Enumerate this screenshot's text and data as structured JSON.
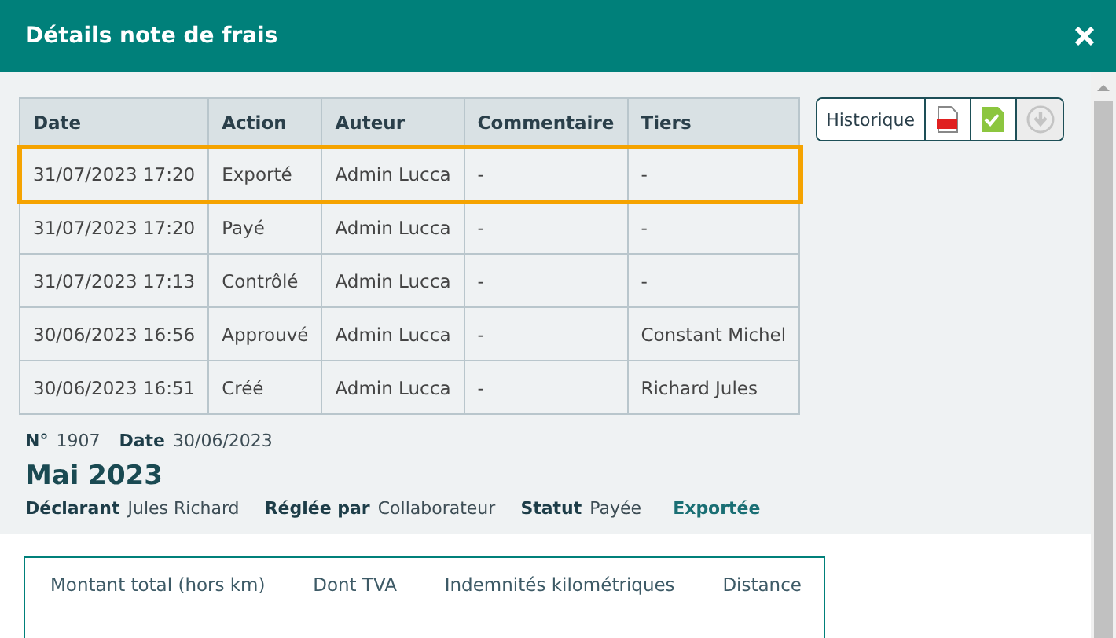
{
  "window": {
    "title": "Détails note de frais"
  },
  "history": {
    "columns": [
      "Date",
      "Action",
      "Auteur",
      "Commentaire",
      "Tiers"
    ],
    "rows": [
      {
        "cells": [
          "31/07/2023 17:20",
          "Exporté",
          "Admin Lucca",
          "-",
          "-"
        ],
        "selected": true
      },
      {
        "cells": [
          "31/07/2023 17:20",
          "Payé",
          "Admin Lucca",
          "-",
          "-"
        ],
        "selected": false
      },
      {
        "cells": [
          "31/07/2023 17:13",
          "Contrôlé",
          "Admin Lucca",
          "-",
          "-"
        ],
        "selected": false
      },
      {
        "cells": [
          "30/06/2023 16:56",
          "Approuvé",
          "Admin Lucca",
          "-",
          "Constant Michel"
        ],
        "selected": false
      },
      {
        "cells": [
          "30/06/2023 16:51",
          "Créé",
          "Admin Lucca",
          "-",
          "Richard Jules"
        ],
        "selected": false
      }
    ]
  },
  "toolbar": {
    "history_button": "Historique",
    "buttons": [
      {
        "kind": "pdf",
        "disabled": false
      },
      {
        "kind": "approve",
        "disabled": false
      },
      {
        "kind": "download",
        "disabled": true
      }
    ]
  },
  "report": {
    "number_label": "N°",
    "number": "1907",
    "date_label": "Date",
    "date": "30/06/2023",
    "title": "Mai 2023",
    "fields": [
      {
        "label": "Déclarant",
        "value": "Jules Richard"
      },
      {
        "label": "Réglée par",
        "value": "Collaborateur"
      },
      {
        "label": "Statut",
        "value": "Payée"
      }
    ],
    "export_status": "Exportée"
  },
  "summary": {
    "columns": [
      "Montant total (hors km)",
      "Dont TVA",
      "Indemnités kilométriques",
      "Distance"
    ]
  }
}
